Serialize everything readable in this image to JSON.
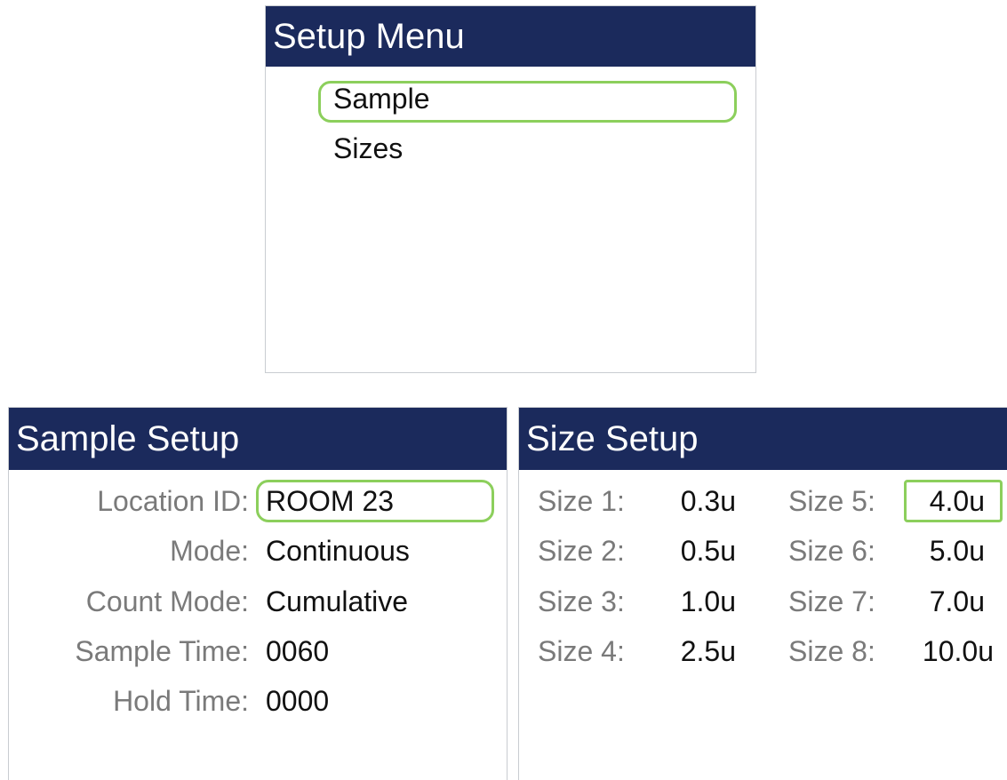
{
  "setup_menu": {
    "title": "Setup Menu",
    "items": [
      "Sample",
      "Sizes"
    ],
    "selected": "Sample"
  },
  "sample_setup": {
    "title": "Sample Setup",
    "fields": [
      {
        "label": "Location ID:",
        "value": "ROOM 23"
      },
      {
        "label": "Mode:",
        "value": "Continuous"
      },
      {
        "label": "Count Mode:",
        "value": "Cumulative"
      },
      {
        "label": "Sample Time:",
        "value": "0060"
      },
      {
        "label": "Hold Time:",
        "value": "0000"
      }
    ]
  },
  "size_setup": {
    "title": "Size Setup",
    "sizes": [
      {
        "label": "Size 1:",
        "value": "0.3u"
      },
      {
        "label": "Size 2:",
        "value": "0.5u"
      },
      {
        "label": "Size 3:",
        "value": "1.0u"
      },
      {
        "label": "Size 4:",
        "value": "2.5u"
      },
      {
        "label": "Size 5:",
        "value": "4.0u"
      },
      {
        "label": "Size 6:",
        "value": "5.0u"
      },
      {
        "label": "Size 7:",
        "value": "7.0u"
      },
      {
        "label": "Size 8:",
        "value": "10.0u"
      }
    ]
  },
  "colors": {
    "header_bg": "#1b2a5c",
    "header_text": "#ffffff",
    "selection_border": "#8ccf5c",
    "label_text": "#7a7a7a",
    "value_text": "#111111"
  }
}
